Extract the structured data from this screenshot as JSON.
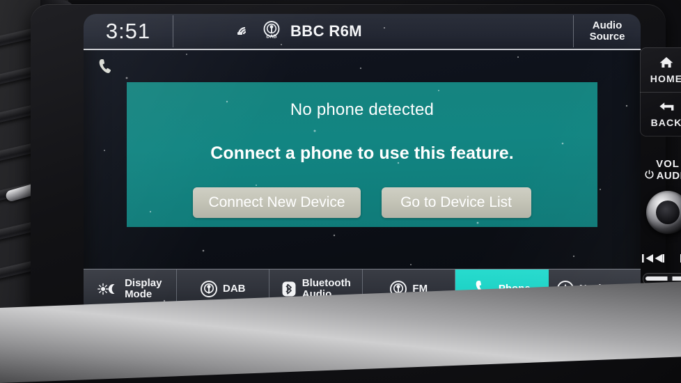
{
  "status_bar": {
    "clock": "3:51",
    "signal_icon": "signal-strength-icon",
    "dab_icon": "dab-broadcast-icon",
    "dab_icon_label": "DAB",
    "station": "BBC R6M",
    "audio_source_line1": "Audio",
    "audio_source_line2": "Source"
  },
  "screen": {
    "phone_status_icon": "phone-handset-icon"
  },
  "dialog": {
    "title": "No phone detected",
    "message": "Connect a phone to use this feature.",
    "buttons": [
      {
        "label": "Connect New Device",
        "name": "connect-new-device-button"
      },
      {
        "label": "Go to Device List",
        "name": "go-to-device-list-button"
      }
    ],
    "background_color": "#128582",
    "button_color": "#c3c3b6"
  },
  "tabs": [
    {
      "label_line1": "Display",
      "label_line2": "Mode",
      "icon": "sun-moon-icon",
      "name": "tab-display-mode",
      "active": false
    },
    {
      "label_line1": "DAB",
      "label_line2": "",
      "icon": "broadcast-icon",
      "name": "tab-dab",
      "active": false
    },
    {
      "label_line1": "Bluetooth",
      "label_line2": "Audio",
      "icon": "bluetooth-icon",
      "name": "tab-bluetooth-audio",
      "active": false
    },
    {
      "label_line1": "FM",
      "label_line2": "",
      "icon": "broadcast-icon",
      "name": "tab-fm",
      "active": false
    },
    {
      "label_line1": "Phone",
      "label_line2": "",
      "icon": "phone-handset-icon",
      "name": "tab-phone",
      "active": true
    },
    {
      "label_line1": "Navigation",
      "label_line2": "",
      "icon": "navigation-arrow-icon",
      "name": "tab-navigation",
      "active": false
    }
  ],
  "hard_keys": {
    "home_label": "HOME",
    "home_icon": "house-icon",
    "back_label": "BACK",
    "back_icon": "back-arrow-icon",
    "volume_label_top": "VOL",
    "volume_label_bottom": "AUDIO",
    "power_icon": "power-icon",
    "prev_icon": "skip-previous-icon",
    "next_icon": "skip-next-icon"
  },
  "theme": {
    "accent_teal": "#128582",
    "active_tab_cyan": "#1ed3c6",
    "status_bar_bg": "#232733",
    "tab_bar_bg": "#2f323a"
  }
}
